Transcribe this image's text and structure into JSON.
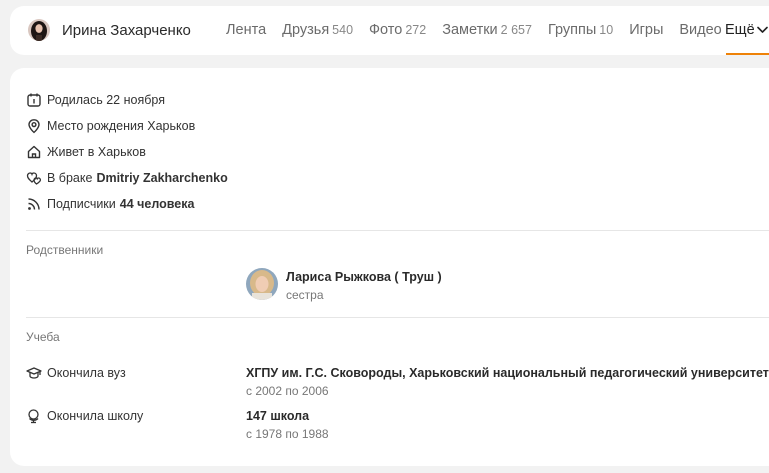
{
  "header": {
    "profile_name": "Ирина Захарченко",
    "nav": [
      {
        "label": "Лента",
        "count": ""
      },
      {
        "label": "Друзья",
        "count": "540"
      },
      {
        "label": "Фото",
        "count": "272"
      },
      {
        "label": "Заметки",
        "count": "2 657"
      },
      {
        "label": "Группы",
        "count": "10"
      },
      {
        "label": "Игры",
        "count": ""
      },
      {
        "label": "Видео",
        "count": ""
      }
    ],
    "more_label": "Ещё",
    "accent_color": "#ee8208"
  },
  "info": {
    "birthday": "Родилась 22 ноября",
    "birthplace": "Место рождения Харьков",
    "lives": "Живет в Харьков",
    "marriage_prefix": "В браке",
    "spouse": "Dmitriy Zakharchenko",
    "followers_prefix": "Подписчики",
    "followers_count": "44 человека"
  },
  "relatives": {
    "title": "Родственники",
    "person_name": "Лариса Рыжкова ( Труш )",
    "person_role": "сестра"
  },
  "education": {
    "title": "Учеба",
    "university_label": "Окончила вуз",
    "university_name": "ХГПУ им. Г.С. Сковороды, Харьковский национальный педагогический университет …",
    "university_years": "с 2002 по 2006",
    "school_label": "Окончила школу",
    "school_name": "147 школа",
    "school_years": "с 1978 по 1988"
  }
}
